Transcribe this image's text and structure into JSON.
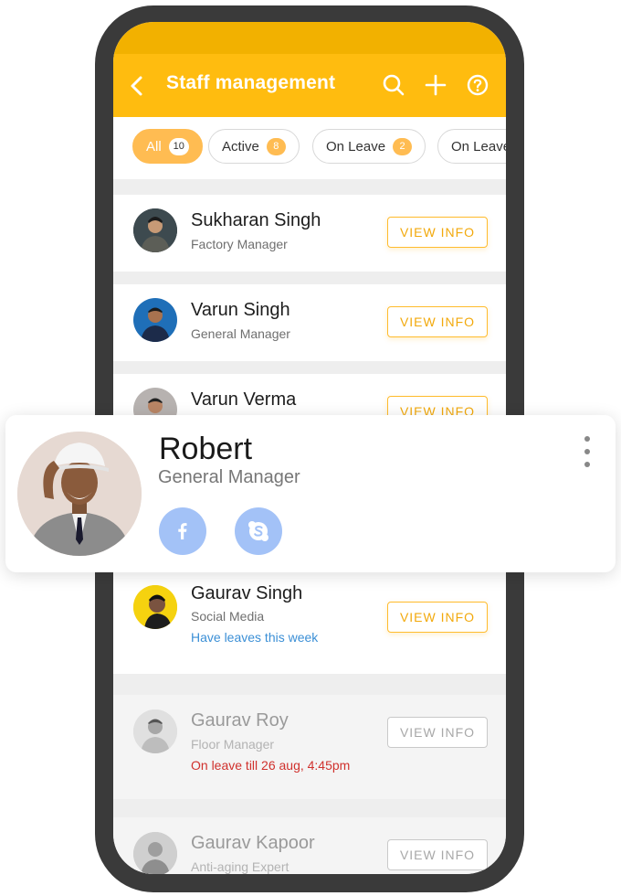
{
  "header": {
    "title": "Staff management"
  },
  "filters": [
    {
      "label": "All",
      "count": "10"
    },
    {
      "label": "Active",
      "count": "8"
    },
    {
      "label": "On Leave",
      "count": "2"
    },
    {
      "label": "On Leave"
    }
  ],
  "staff": [
    {
      "name": "Sukharan Singh",
      "role": "Factory Manager",
      "button": "VIEW INFO"
    },
    {
      "name": "Varun Singh",
      "role": "General Manager",
      "button": "VIEW INFO"
    },
    {
      "name": "Varun Verma",
      "button": "VIEW INFO"
    },
    {
      "name": "Gaurav Singh",
      "role": "Social Media",
      "note": "Have leaves this week",
      "button": "VIEW INFO"
    },
    {
      "name": "Gaurav Roy",
      "role": "Floor Manager",
      "note": "On leave till 26 aug, 4:45pm",
      "button": "VIEW INFO"
    },
    {
      "name": "Gaurav Kapoor",
      "role": "Anti-aging Expert",
      "button": "VIEW INFO"
    }
  ],
  "profile": {
    "name": "Robert",
    "role": "General Manager",
    "social": [
      "facebook-icon",
      "skype-icon"
    ]
  },
  "colors": {
    "accent": "#ffbc0f",
    "leave_note": "#d0312d",
    "info_note": "#3b8fd6",
    "social": "#a3c2f7"
  }
}
